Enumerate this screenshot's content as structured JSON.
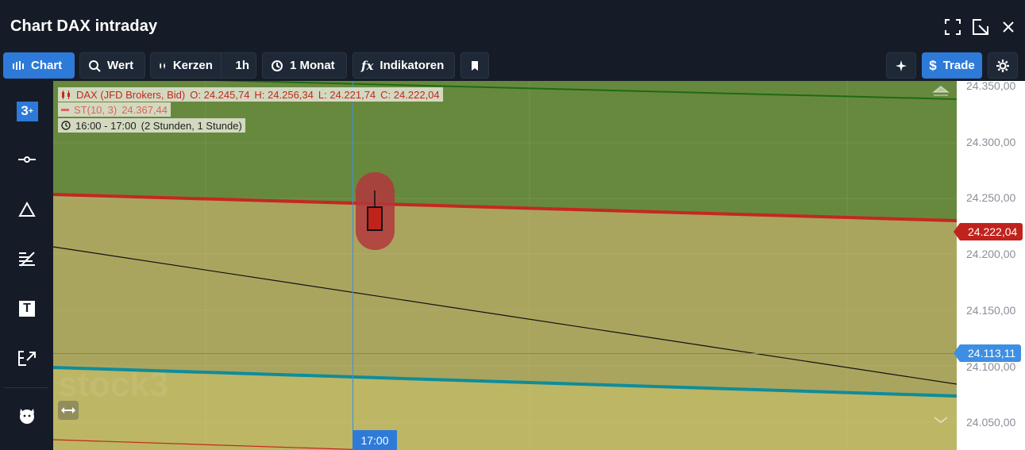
{
  "window": {
    "title": "Chart DAX intraday"
  },
  "toolbar": {
    "chart_label": "Chart",
    "wert_label": "Wert",
    "kerzen_label": "Kerzen",
    "interval_label": "1h",
    "period_label": "1 Monat",
    "indikatoren_label": "Indikatoren",
    "trade_label": "Trade"
  },
  "legend": {
    "instrument": "DAX (JFD Brokers, Bid)",
    "open": "O: 24.245,74",
    "high": "H: 24.256,34",
    "low": "L: 24.221,74",
    "close": "C: 24.222,04",
    "indicator_name": "ST(10, 3)",
    "indicator_value": "24.367,44",
    "time_range": "16:00 - 17:00",
    "time_detail": "(2 Stunden, 1 Stunde)"
  },
  "yaxis": {
    "ticks": [
      "24.350,00",
      "24.300,00",
      "24.250,00",
      "24.200,00",
      "24.150,00",
      "24.100,00",
      "24.050,00"
    ],
    "last_price": "24.222,04",
    "crosshair_price": "24.113,11"
  },
  "xaxis": {
    "crosshair_time": "17:00"
  },
  "watermark": "stock3",
  "colors": {
    "accent": "#2e7ad8",
    "last_price": "#c0231c",
    "upper_zone": "#67893e",
    "lower_zone": "#a9a55e",
    "supertrend_red": "#c4281e",
    "teal_line": "#0f8c9a",
    "green_line": "#1f6b12"
  },
  "icons": [
    "chart-icon",
    "search-icon",
    "candles-icon",
    "clock-icon",
    "fx-icon",
    "bookmark-icon",
    "sparkle-icon",
    "gear-icon",
    "fullscreen-icon",
    "popout-icon",
    "close-icon",
    "timeframe-icon",
    "crosshair-tool-icon",
    "triangle-icon",
    "fibonacci-icon",
    "text-tool-icon",
    "arrow-tool-icon",
    "bull-bear-icon",
    "resize-arrows-icon"
  ]
}
